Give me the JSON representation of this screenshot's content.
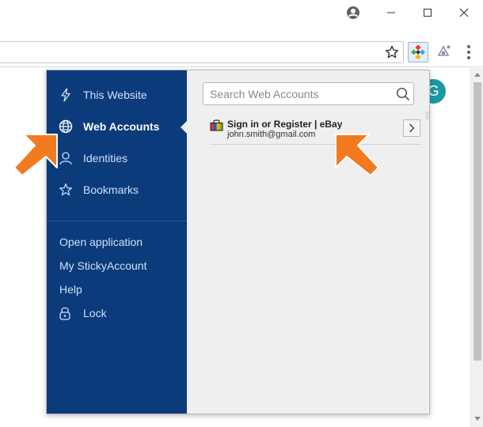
{
  "browser": {
    "window_controls": [
      "minimize",
      "maximize",
      "close"
    ],
    "profile_icon": "account-circle-icon",
    "page_avatar_letter": "G",
    "colors": {
      "avatar": "#1a9aa3",
      "sidebar": "#0c3b7c",
      "arrow": "#f47a20"
    }
  },
  "popup": {
    "nav": [
      {
        "label": "This Website",
        "icon": "lightning-icon",
        "active": false
      },
      {
        "label": "Web Accounts",
        "icon": "globe-icon",
        "active": true
      },
      {
        "label": "Identities",
        "icon": "person-icon",
        "active": false
      },
      {
        "label": "Bookmarks",
        "icon": "star-icon",
        "active": false
      }
    ],
    "links": [
      {
        "label": "Open application"
      },
      {
        "label": "My StickyAccount"
      },
      {
        "label": "Help"
      }
    ],
    "lock": {
      "label": "Lock",
      "icon": "lock-icon"
    },
    "search": {
      "placeholder": "Search Web Accounts",
      "value": ""
    },
    "accounts": [
      {
        "title": "Sign in or Register | eBay",
        "email": "john.smith@gmail.com",
        "icon": "shopping-bag-icon"
      }
    ]
  }
}
